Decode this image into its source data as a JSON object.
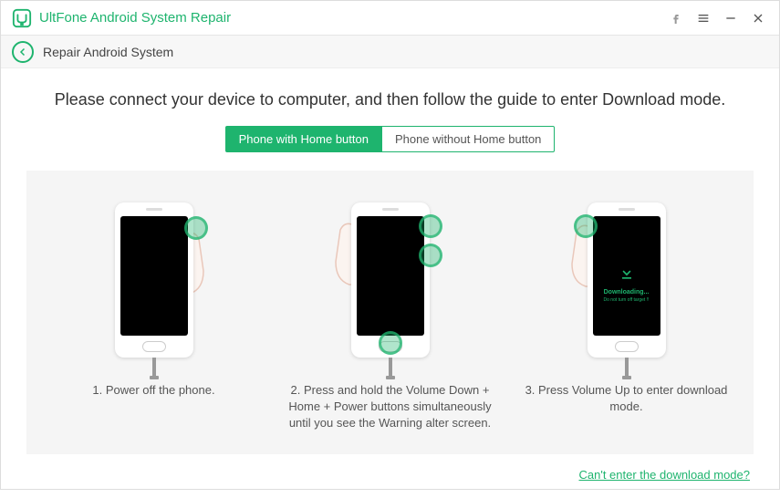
{
  "app": {
    "title": "UltFone Android System Repair"
  },
  "subbar": {
    "title": "Repair Android System"
  },
  "instruction": "Please connect your device to computer, and then follow the guide to enter Download mode.",
  "tabs": {
    "with_home": "Phone with Home button",
    "without_home": "Phone without Home button"
  },
  "steps": {
    "s1": "1. Power off the phone.",
    "s2": "2. Press and hold the Volume Down + Home + Power buttons simultaneously until you see the Warning alter screen.",
    "s3": "3. Press Volume Up to enter download mode."
  },
  "download_screen": {
    "title": "Downloading...",
    "subtitle": "Do not turn off target !!"
  },
  "footer": {
    "link": "Can't enter the download mode?"
  },
  "colors": {
    "accent": "#1eb46e"
  }
}
